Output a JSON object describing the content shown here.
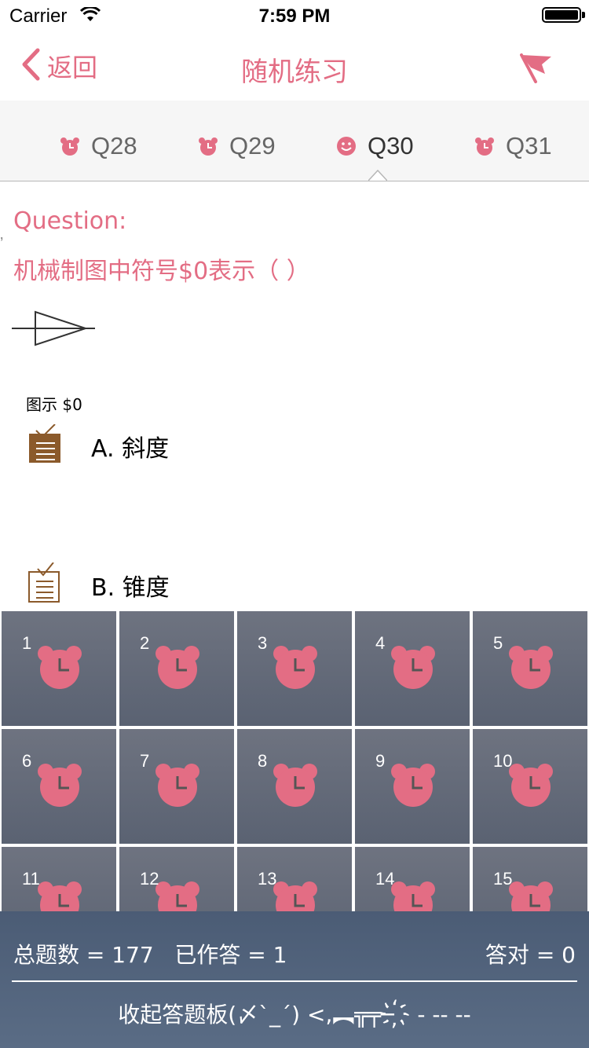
{
  "status_bar": {
    "carrier": "Carrier",
    "time": "7:59 PM"
  },
  "nav": {
    "back_label": "返回",
    "title": "随机练习"
  },
  "tabs": [
    {
      "label": "Q28",
      "icon": "alarm-clock-icon"
    },
    {
      "label": "Q29",
      "icon": "alarm-clock-icon"
    },
    {
      "label": "Q30",
      "icon": "smiley-icon",
      "active": true
    },
    {
      "label": "Q31",
      "icon": "alarm-clock-icon"
    }
  ],
  "question": {
    "label": "Question:",
    "text": "机械制图中符号$0表示（  ）",
    "figure_caption": "图示 $0"
  },
  "options": [
    {
      "text": "A. 斜度",
      "icon": "checklist-filled-icon"
    },
    {
      "text": "B. 锥度",
      "icon": "checklist-outline-icon"
    }
  ],
  "answer_board": {
    "cells": [
      "1",
      "2",
      "3",
      "4",
      "5",
      "6",
      "7",
      "8",
      "9",
      "10",
      "11",
      "12",
      "13",
      "14",
      "15"
    ],
    "stats": "总题数 = 177   已作答 = 1",
    "correct": "答对 = 0",
    "collapse_label": "收起答题板(〆`_´) <,︻╦╤─ ҉ - -- --"
  },
  "colors": {
    "accent": "#e36d84",
    "board_dark": "#4b5c75",
    "option_icon": "#8b5a2b"
  }
}
